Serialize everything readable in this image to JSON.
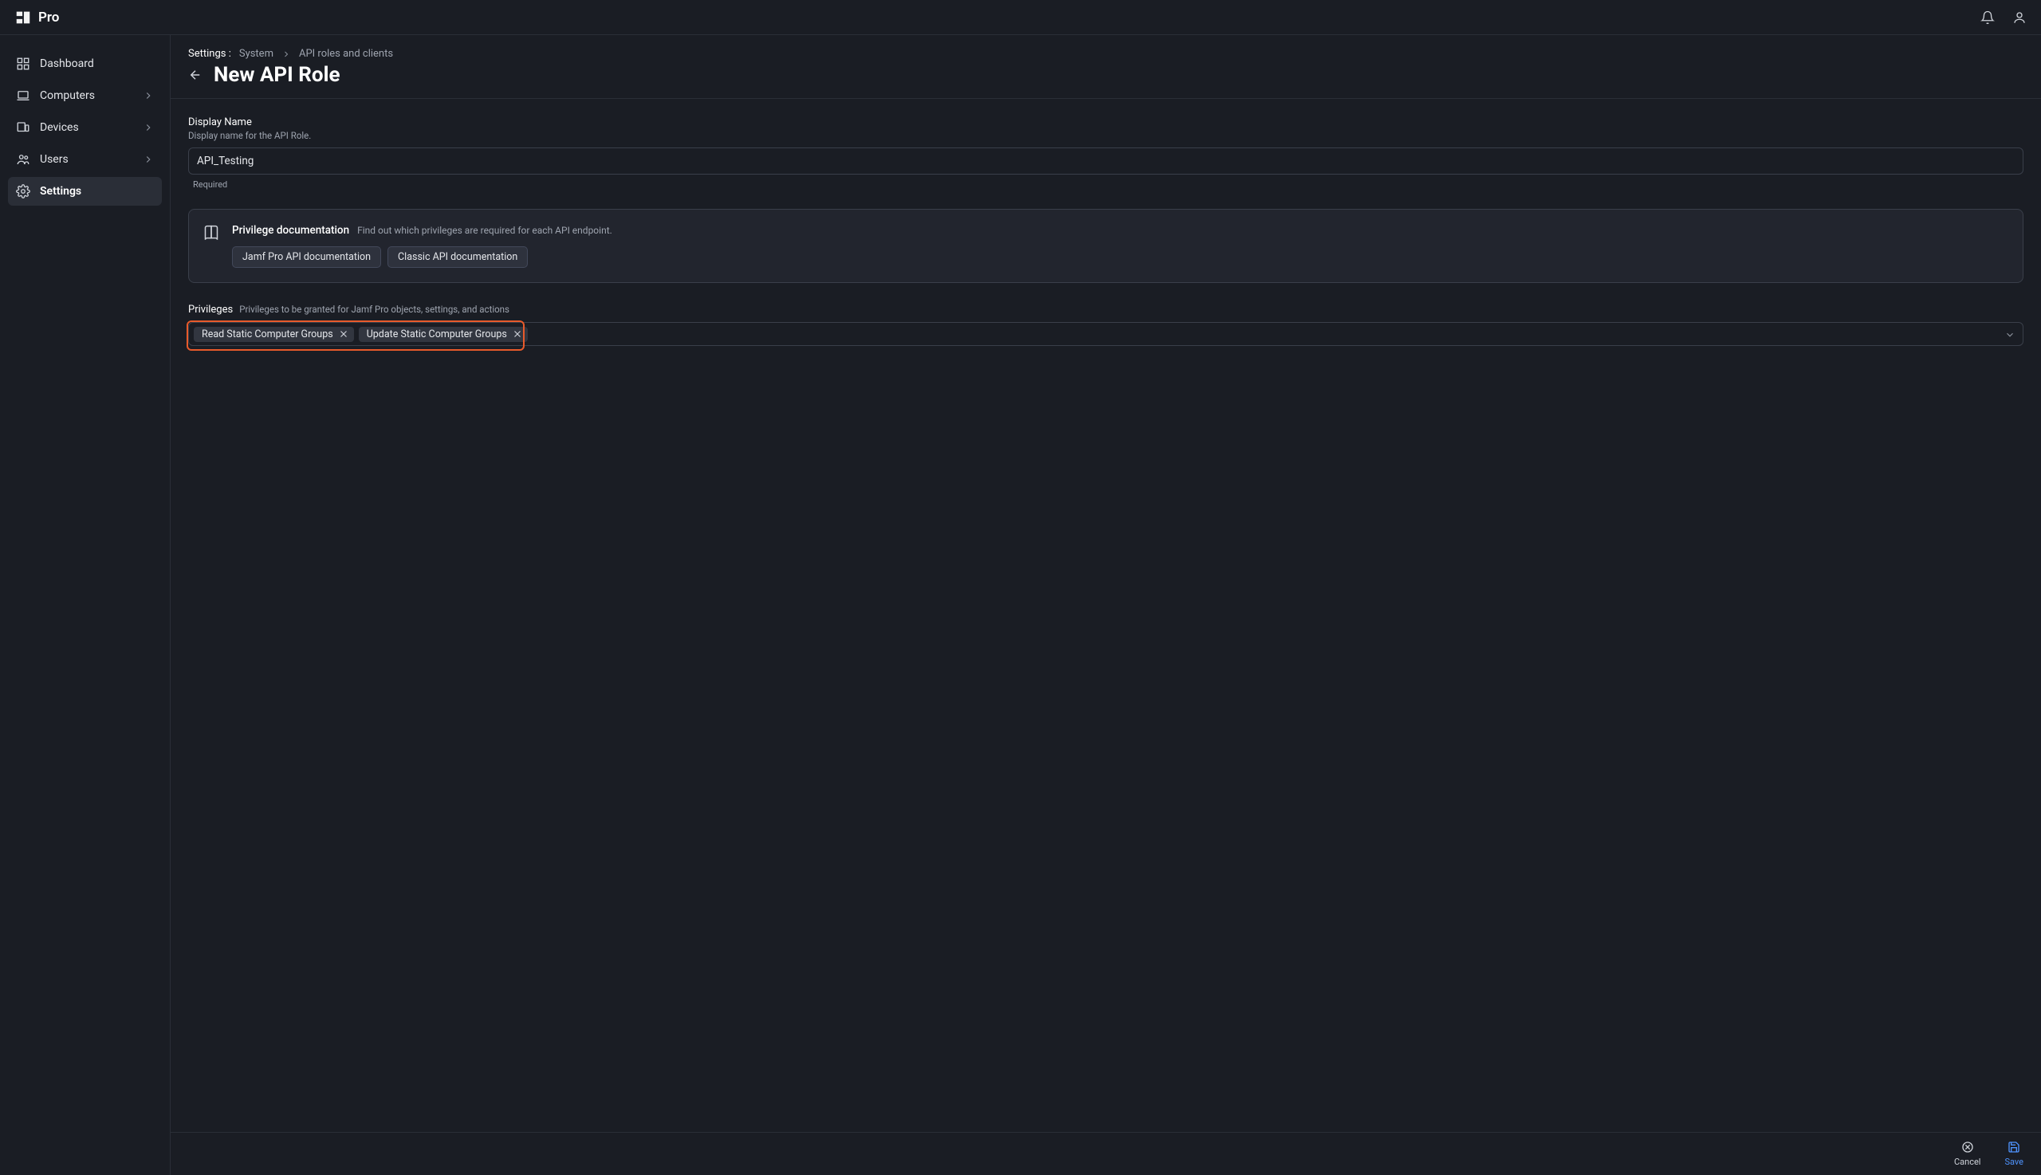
{
  "brand": {
    "name": "Pro"
  },
  "sidebar": {
    "items": [
      {
        "label": "Dashboard",
        "expandable": false,
        "active": false,
        "icon": "dashboard-icon"
      },
      {
        "label": "Computers",
        "expandable": true,
        "active": false,
        "icon": "laptop-icon"
      },
      {
        "label": "Devices",
        "expandable": true,
        "active": false,
        "icon": "devices-icon"
      },
      {
        "label": "Users",
        "expandable": true,
        "active": false,
        "icon": "users-icon"
      },
      {
        "label": "Settings",
        "expandable": false,
        "active": true,
        "icon": "gear-icon"
      }
    ]
  },
  "breadcrumb": {
    "prefix": "Settings :",
    "items": [
      "System",
      "API roles and clients"
    ]
  },
  "page": {
    "title": "New API Role"
  },
  "display_name": {
    "label": "Display Name",
    "hint": "Display name for the API Role.",
    "value": "API_Testing",
    "required_label": "Required"
  },
  "doc_card": {
    "title": "Privilege documentation",
    "subtitle": "Find out which privileges are required for each API endpoint.",
    "buttons": [
      "Jamf Pro API documentation",
      "Classic API documentation"
    ]
  },
  "privileges": {
    "label": "Privileges",
    "hint": "Privileges to be granted for Jamf Pro objects, settings, and actions",
    "selected": [
      "Read Static Computer Groups",
      "Update Static Computer Groups"
    ]
  },
  "footer": {
    "cancel": "Cancel",
    "save": "Save"
  }
}
